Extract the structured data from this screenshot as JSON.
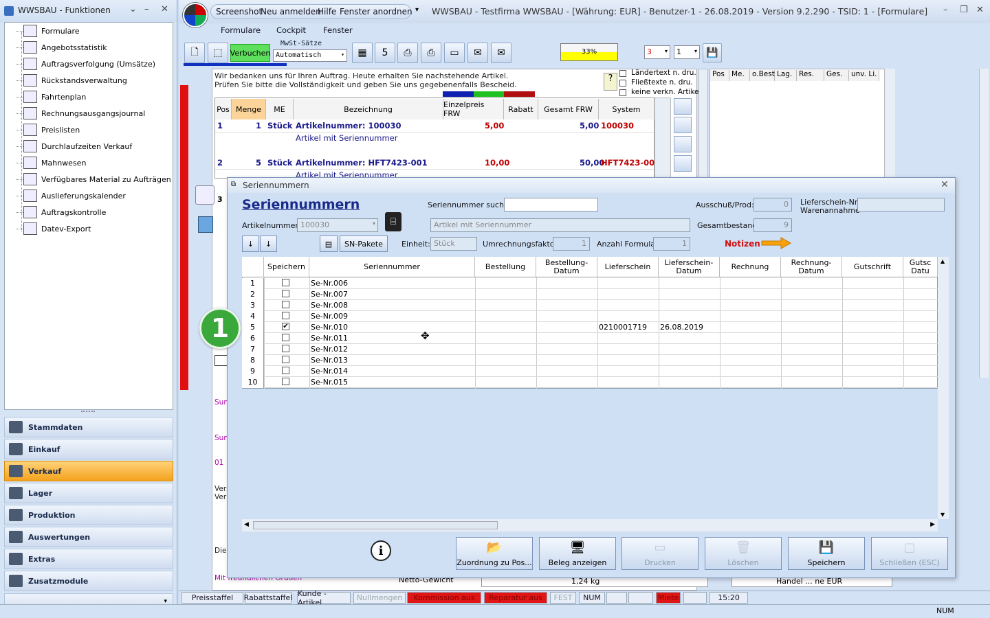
{
  "left_window": {
    "title": "WWSBAU - Funktionen",
    "functions": [
      "Formulare",
      "Angebotsstatistik",
      "Auftragsverfolgung (Umsätze)",
      "Rückstandsverwaltung",
      "Fahrtenplan",
      "Rechnungsausgangsjournal",
      "Preislisten",
      "Durchlaufzeiten Verkauf",
      "Mahnwesen",
      "Verfügbares Material zu Aufträgen",
      "Auslieferungskalender",
      "Auftragskontrolle",
      "Datev-Export"
    ],
    "datev_icon_text": "DATEV",
    "nav": [
      "Stammdaten",
      "Einkauf",
      "Verkauf",
      "Lager",
      "Produktion",
      "Auswertungen",
      "Extras",
      "Zusatzmodule"
    ],
    "active_nav": "Verkauf"
  },
  "main_window": {
    "quick_menu": [
      "Screenshot",
      "Neu anmelden",
      "Hilfe",
      "Fenster anordnen"
    ],
    "title": "WWSBAU - Testfirma WWSBAU - [Währung: EUR] - Benutzer-1 - 26.08.2019 - Version 9.2.290 - TSID: 1  - [Formulare]",
    "menu": [
      "Formulare",
      "Cockpit",
      "Fenster"
    ],
    "toolbar": {
      "verbuchen": "Verbuchen",
      "mwst_label": "MwSt-Sätze",
      "mwst_value": "Automatisch",
      "progress_text": "33%",
      "progress": 0.33,
      "sel1": "3",
      "sel2": "1"
    },
    "document": {
      "text_line1": "Wir bedanken uns für Ihren Auftrag. Heute erhalten Sie nachstehende Artikel.",
      "text_line2": "Prüfen Sie bitte die Vollständigkeit und geben Sie uns gegebenenfalls Bescheid.",
      "options": [
        "Ländertext n. dru.",
        "Fließtexte n. dru.",
        "keine verkn. Artikel"
      ],
      "columns": [
        "Pos",
        "Menge",
        "ME",
        "Bezeichnung",
        "Einzelpreis FRW",
        "Rabatt",
        "Gesamt FRW",
        "System"
      ],
      "rows": [
        {
          "pos": "1",
          "menge": "1",
          "me": "Stück",
          "bez": "Artikelnummer: 100030",
          "bez2": "Artikel mit Seriennummer",
          "preis": "5,00",
          "gesamt": "5,00",
          "system": "100030"
        },
        {
          "pos": "2",
          "menge": "5",
          "me": "Stück",
          "bez": "Artikelnummer: HFT7423-001",
          "bez2": "Artikel mit Seriennummer",
          "preis": "10,00",
          "gesamt": "50,00",
          "system": "HFT7423-001"
        }
      ],
      "pos3": "3",
      "right_columns": [
        "Pos",
        "Me.",
        "o.Best",
        "Lag.",
        "Res.",
        "Ges.",
        "unv. Li."
      ],
      "side_labels": [
        "Sum",
        "Sum",
        "01",
        "Vers",
        "Verp",
        "Die",
        "Mit freundlichen Grüßen"
      ],
      "netto_label": "Netto-Gewicht",
      "netto_value": "1,24 kg",
      "handel_text": "Handel ... ne EUR"
    },
    "status_bar": [
      "Preisstaffel",
      "Rabattstaffel",
      "Kunde - Artikel",
      "Nullmengen",
      "Kommission aus",
      "Reparatur aus",
      "FEST",
      "NUM",
      "Miete",
      "15:20"
    ],
    "bottom_status": "NUM"
  },
  "dialog": {
    "title": "Seriennummern",
    "heading": "Seriennummern",
    "search_label": "Seriennummer suchen:",
    "search_value": "",
    "artikel_label": "Artikelnummer:",
    "artikel_value": "100030",
    "artikel_desc": "Artikel mit Seriennummer",
    "ausschuss_label": "Ausschuß/Prod:",
    "ausschuss_value": "0",
    "gesamt_label": "Gesamtbestand:",
    "gesamt_value": "9",
    "lieferschein_label1": "Lieferschein-Nr.",
    "lieferschein_label2": "Warenannahme",
    "lieferschein_value": "",
    "sn_pakete": "SN-Pakete",
    "einheit_label": "Einheit:",
    "einheit_value": "Stück",
    "umrechnung_label": "Umrechnungsfaktor:",
    "umrechnung_value": "1",
    "anzahl_label": "Anzahl Formular:",
    "anzahl_value": "1",
    "notizen": "Notizen",
    "columns": [
      "Speichern",
      "Seriennummer",
      "Bestellung",
      "Bestellung-\nDatum",
      "Lieferschein",
      "Lieferschein-\nDatum",
      "Rechnung",
      "Rechnung-\nDatum",
      "Gutschrift",
      "Gutsc\nDatu"
    ],
    "rows": [
      {
        "n": "1",
        "checked": false,
        "sn": "Se-Nr.006",
        "ls": "",
        "lsd": ""
      },
      {
        "n": "2",
        "checked": false,
        "sn": "Se-Nr.007",
        "ls": "",
        "lsd": ""
      },
      {
        "n": "3",
        "checked": false,
        "sn": "Se-Nr.008",
        "ls": "",
        "lsd": ""
      },
      {
        "n": "4",
        "checked": false,
        "sn": "Se-Nr.009",
        "ls": "",
        "lsd": ""
      },
      {
        "n": "5",
        "checked": true,
        "sn": "Se-Nr.010",
        "ls": "0210001719",
        "lsd": "26.08.2019"
      },
      {
        "n": "6",
        "checked": false,
        "sn": "Se-Nr.011",
        "ls": "",
        "lsd": ""
      },
      {
        "n": "7",
        "checked": false,
        "sn": "Se-Nr.012",
        "ls": "",
        "lsd": ""
      },
      {
        "n": "8",
        "checked": false,
        "sn": "Se-Nr.013",
        "ls": "",
        "lsd": ""
      },
      {
        "n": "9",
        "checked": false,
        "sn": "Se-Nr.014",
        "ls": "",
        "lsd": ""
      },
      {
        "n": "10",
        "checked": false,
        "sn": "Se-Nr.015",
        "ls": "",
        "lsd": ""
      }
    ],
    "buttons": [
      {
        "label": "Zuordnung zu Pos...",
        "enabled": true
      },
      {
        "label": "Beleg anzeigen",
        "enabled": true
      },
      {
        "label": "Drucken",
        "enabled": false
      },
      {
        "label": "Löschen",
        "enabled": false
      },
      {
        "label": "Speichern",
        "enabled": true
      },
      {
        "label": "Schließen (ESC)",
        "enabled": false
      }
    ],
    "step_marker": "1"
  },
  "colors": {
    "active_nav": "#f4a21c",
    "accent_red": "#d01010",
    "verbuchen": "#5ee05e",
    "marker": "#3aa83a"
  }
}
